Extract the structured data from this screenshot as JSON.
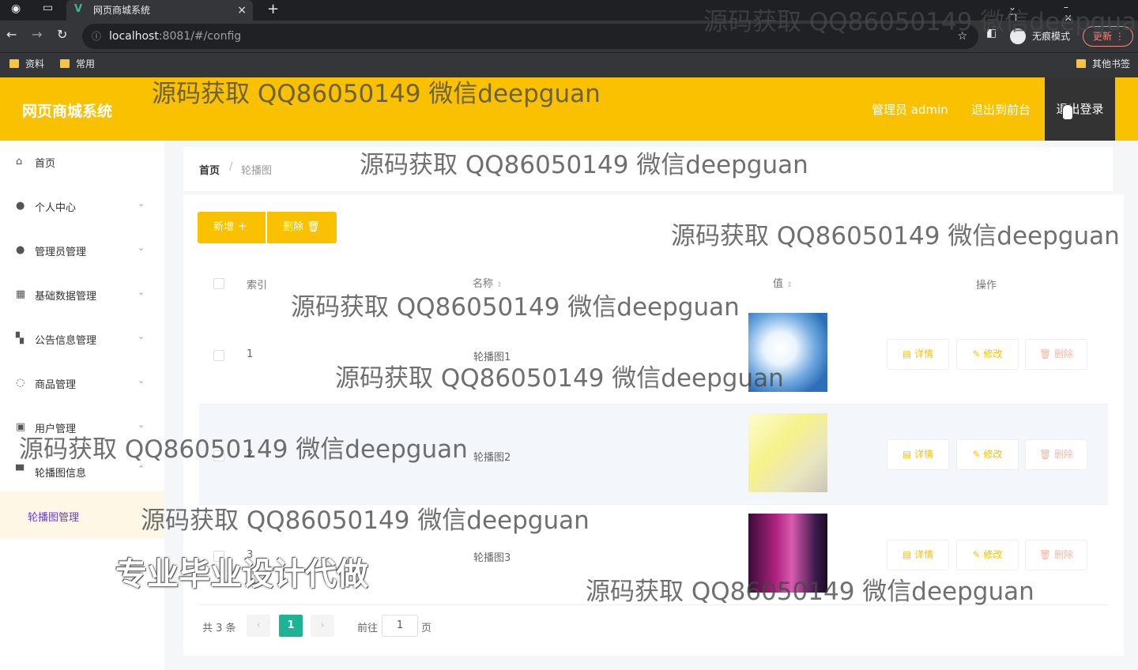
{
  "browser": {
    "tab_title": "网页商城系统",
    "tab_close": "×",
    "new_tab": "+",
    "url_host": "localhost",
    "url_path": ":8081/#/config",
    "incognito_label": "无痕模式",
    "update_label": "更新",
    "bookmarks": [
      "资料",
      "常用"
    ],
    "other_bookmarks": "其他书签"
  },
  "header": {
    "brand": "网页商城系统",
    "user_label": "管理员 admin",
    "front_link": "退出到前台",
    "logout": "退出登录"
  },
  "sidebar": {
    "items": [
      {
        "label": "首页",
        "icon": "home-icon",
        "expandable": false
      },
      {
        "label": "个人中心",
        "icon": "user-icon",
        "expandable": true
      },
      {
        "label": "管理员管理",
        "icon": "leaf-icon",
        "expandable": true
      },
      {
        "label": "基础数据管理",
        "icon": "grid-icon",
        "expandable": true
      },
      {
        "label": "公告信息管理",
        "icon": "tiles-icon",
        "expandable": true
      },
      {
        "label": "商品管理",
        "icon": "power-icon",
        "expandable": true
      },
      {
        "label": "用户管理",
        "icon": "users-icon",
        "expandable": true
      },
      {
        "label": "轮播图信息",
        "icon": "presentation-icon",
        "expandable": true,
        "expanded": true
      }
    ],
    "sub_item": "轮播图管理"
  },
  "breadcrumb": {
    "home": "首页",
    "separator": "/",
    "current": "轮播图"
  },
  "toolbar": {
    "add": "新增",
    "delete": "删除"
  },
  "table": {
    "columns": [
      "索引",
      "名称",
      "值",
      "操作"
    ],
    "rows": [
      {
        "index": "1",
        "name": "轮播图1",
        "thumb": "sky-clouds"
      },
      {
        "index": "2",
        "name": "轮播图2",
        "thumb": "yellow-light"
      },
      {
        "index": "3",
        "name": "轮播图3",
        "thumb": "purple-gradient"
      }
    ],
    "actions": {
      "detail": "详情",
      "edit": "修改",
      "delete": "删除"
    }
  },
  "pagination": {
    "total": "共 3 条",
    "prev": "‹",
    "current": "1",
    "next": "›",
    "goto_label": "前往",
    "goto_value": "1",
    "page_unit": "页"
  },
  "watermarks": {
    "contact": "源码获取 QQ86050149 微信deepguan",
    "promo": "专业毕业设计代做"
  },
  "colors": {
    "accent": "#f9c100",
    "pager_active": "#1fb395",
    "sidebar_active": "#6a3bd6"
  }
}
